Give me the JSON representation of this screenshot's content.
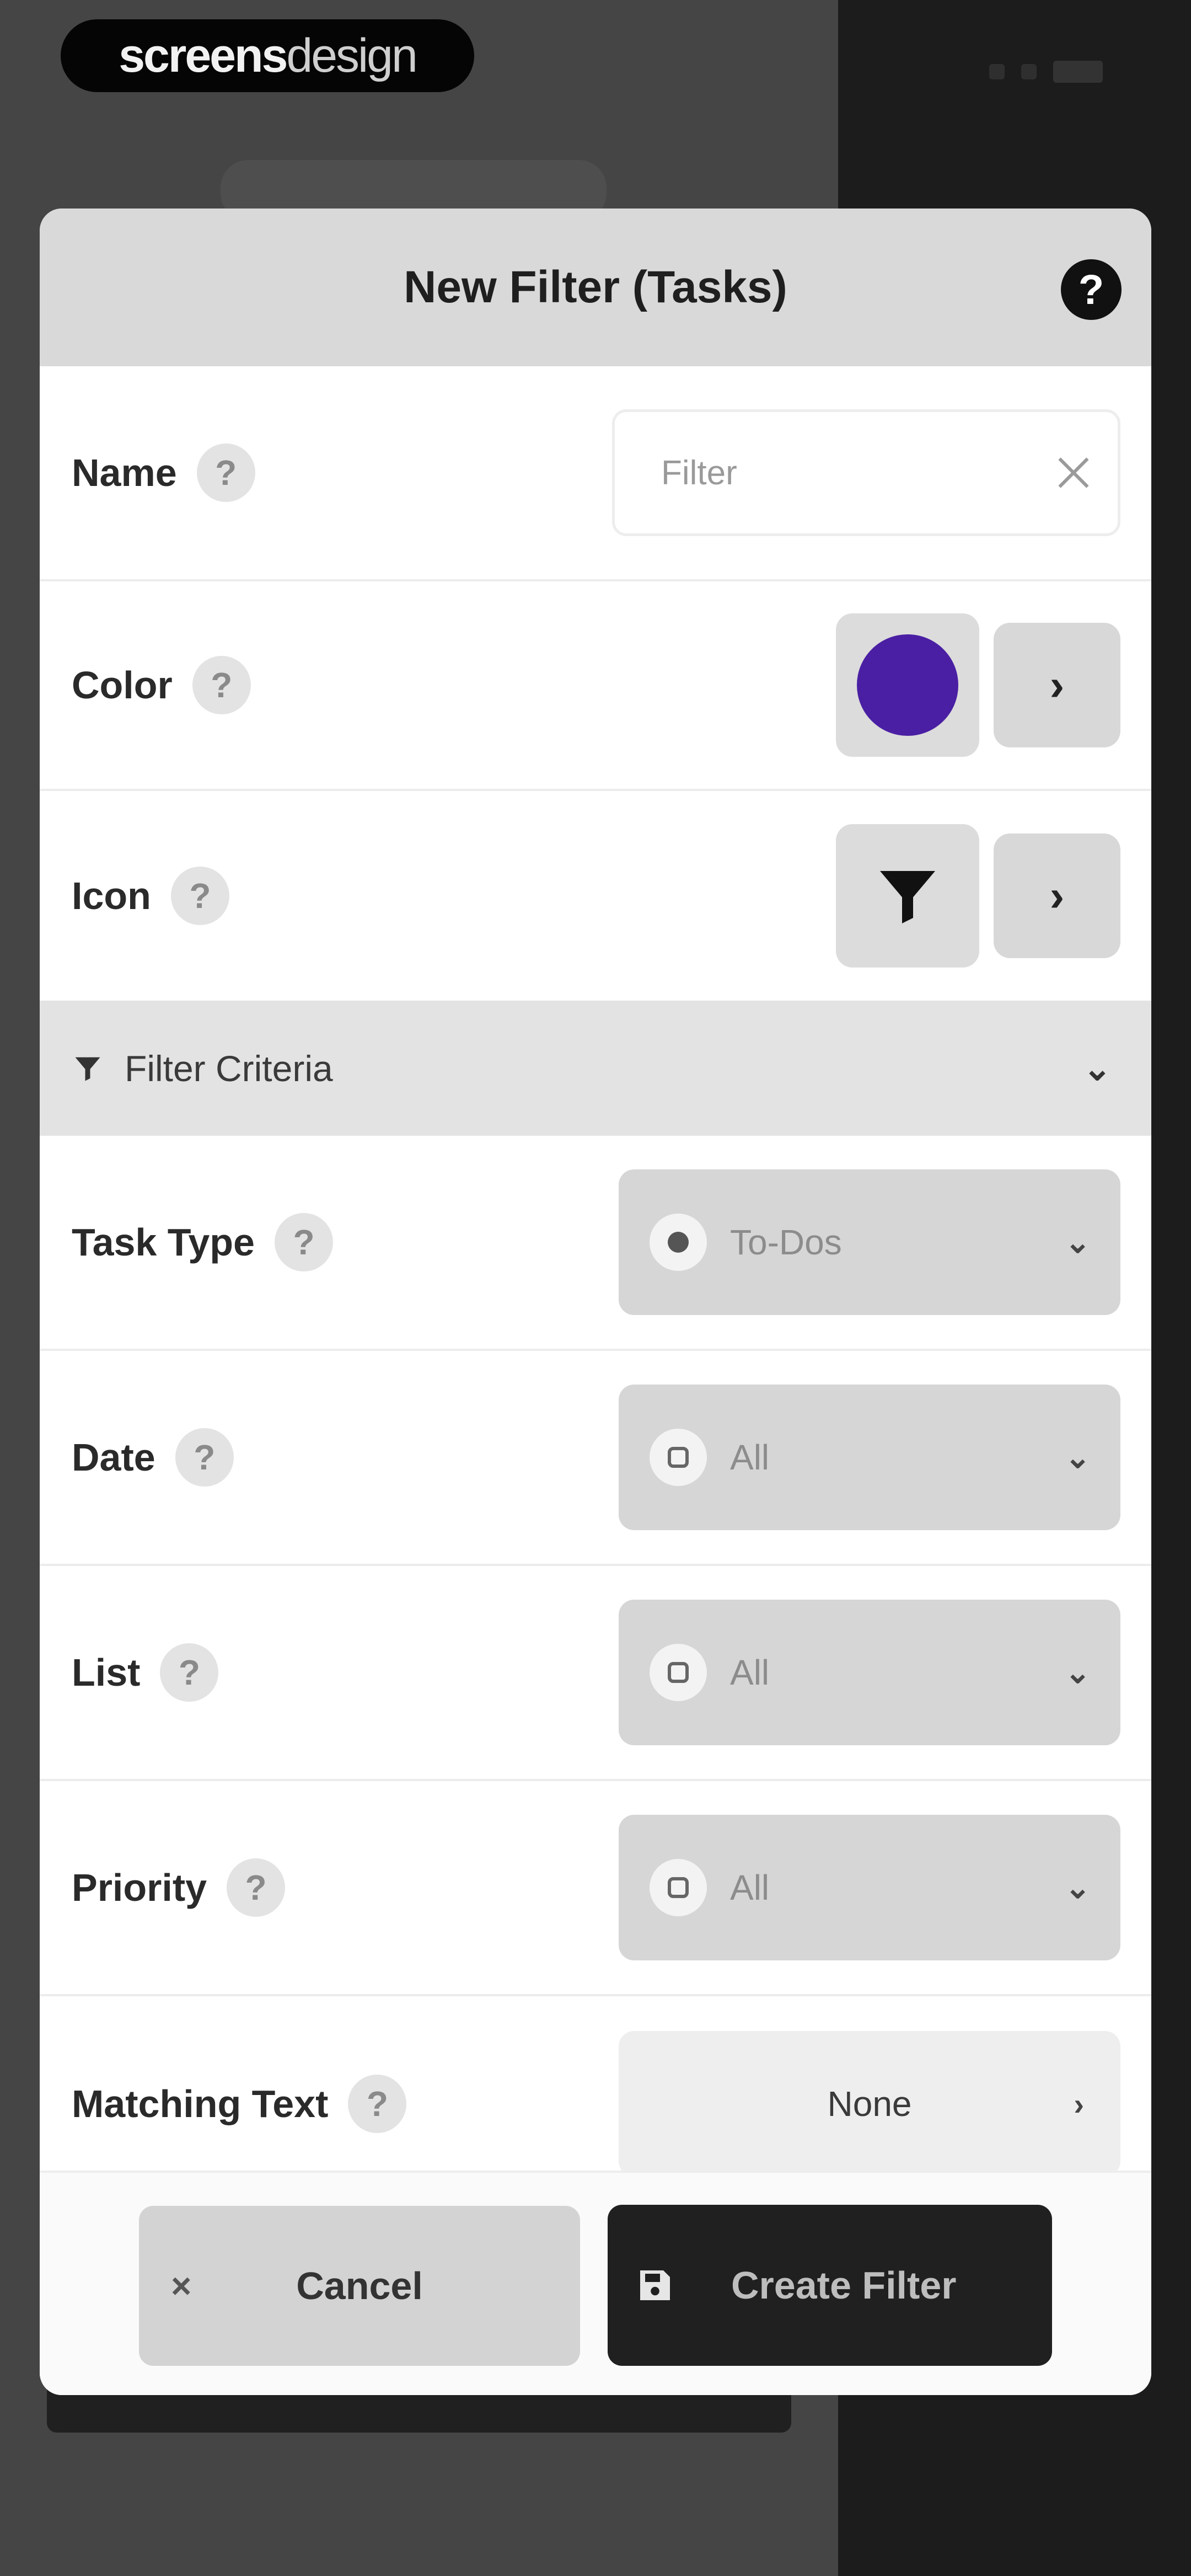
{
  "brand": {
    "bold": "screens",
    "light": "design"
  },
  "modal": {
    "title": "New Filter (Tasks)",
    "help_glyph": "?",
    "name": {
      "label": "Name",
      "value": "Filter"
    },
    "color": {
      "label": "Color",
      "value": "#4a1fa3"
    },
    "icon": {
      "label": "Icon",
      "icon_name": "funnel-icon"
    },
    "section": {
      "title": "Filter Criteria"
    },
    "task_type": {
      "label": "Task Type",
      "value": "To-Dos"
    },
    "date": {
      "label": "Date",
      "value": "All"
    },
    "list": {
      "label": "List",
      "value": "All"
    },
    "priority": {
      "label": "Priority",
      "value": "All"
    },
    "matching_text": {
      "label": "Matching Text",
      "value": "None"
    }
  },
  "footer": {
    "cancel": "Cancel",
    "create": "Create Filter"
  },
  "glyphs": {
    "chevron_right": "›",
    "chevron_down": "⌄",
    "close": "×"
  }
}
